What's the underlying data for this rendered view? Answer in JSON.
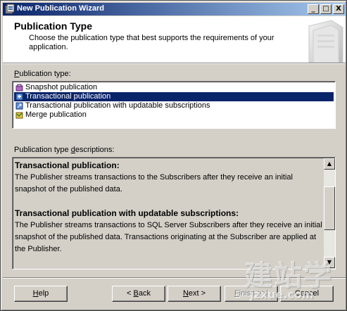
{
  "window": {
    "title": "New Publication Wizard",
    "minimize_glyph": "_",
    "maximize_glyph": "□",
    "close_glyph": "X"
  },
  "header": {
    "title": "Publication Type",
    "description": "Choose the publication type that best supports the requirements of your application."
  },
  "publication_type": {
    "label_underlined": "P",
    "label_rest": "ublication type:",
    "selected_index": 1,
    "items": [
      {
        "label": "Snapshot publication",
        "icon": "snapshot-publication-icon"
      },
      {
        "label": "Transactional publication",
        "icon": "transactional-publication-icon"
      },
      {
        "label": "Transactional publication with updatable subscriptions",
        "icon": "updatable-publication-icon"
      },
      {
        "label": "Merge publication",
        "icon": "merge-publication-icon"
      }
    ]
  },
  "descriptions": {
    "label_before": "Publication type ",
    "label_underlined": "d",
    "label_after": "escriptions:",
    "sections": [
      {
        "heading": "Transactional publication:",
        "body": "The Publisher streams transactions to the Subscribers after they receive an initial snapshot of the published data."
      },
      {
        "heading": "Transactional publication with updatable subscriptions:",
        "body": "The Publisher streams transactions to SQL Server Subscribers after they receive an initial snapshot of the published data. Transactions originating at the Subscriber are applied at the Publisher."
      }
    ]
  },
  "buttons": {
    "help_underlined": "H",
    "help_rest": "elp",
    "back_prefix": "< ",
    "back_underlined": "B",
    "back_rest": "ack",
    "next_underlined": "N",
    "next_rest": "ext >",
    "finish_underlined": "F",
    "finish_rest": "inish >>|",
    "cancel": "Cancel"
  },
  "watermark": {
    "text": "建站学",
    "sub": "jzxue.com"
  },
  "colors": {
    "face": "#d4d0c8",
    "selection": "#0a246a",
    "title_gradient_start": "#0a246a",
    "title_gradient_end": "#a6caf0"
  }
}
